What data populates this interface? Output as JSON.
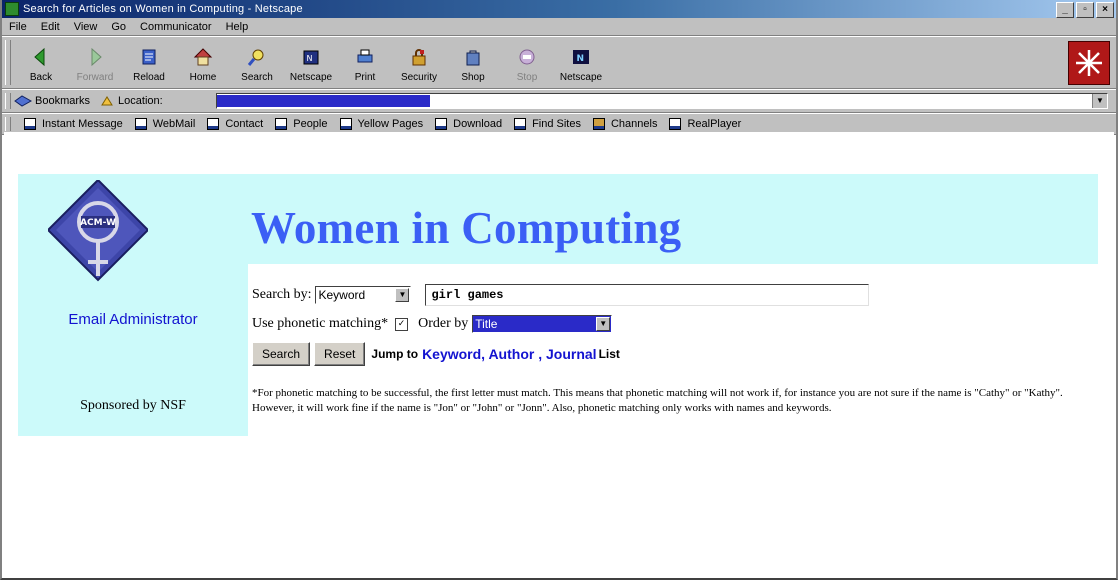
{
  "window": {
    "title": "Search for Articles on Women in Computing - Netscape",
    "controls": [
      "_",
      "▫",
      "×"
    ]
  },
  "menubar": [
    "File",
    "Edit",
    "View",
    "Go",
    "Communicator",
    "Help"
  ],
  "toolbar": {
    "buttons": [
      {
        "label": "Back",
        "icon": "back-arrow-icon",
        "enabled": true
      },
      {
        "label": "Forward",
        "icon": "forward-arrow-icon",
        "enabled": false
      },
      {
        "label": "Reload",
        "icon": "reload-icon",
        "enabled": true
      },
      {
        "label": "Home",
        "icon": "home-icon",
        "enabled": true
      },
      {
        "label": "Search",
        "icon": "search-icon",
        "enabled": true
      },
      {
        "label": "Netscape",
        "icon": "netscape-guide-icon",
        "enabled": true
      },
      {
        "label": "Print",
        "icon": "print-icon",
        "enabled": true
      },
      {
        "label": "Security",
        "icon": "security-icon",
        "enabled": true
      },
      {
        "label": "Shop",
        "icon": "shop-icon",
        "enabled": true
      },
      {
        "label": "Stop",
        "icon": "stop-icon",
        "enabled": false
      },
      {
        "label": "Netscape",
        "icon": "netscape-n-icon",
        "enabled": true
      }
    ]
  },
  "location_bar": {
    "bookmarks_label": "Bookmarks",
    "location_label": "Location:"
  },
  "personal_toolbar": [
    "Instant Message",
    "WebMail",
    "Contact",
    "People",
    "Yellow Pages",
    "Download",
    "Find Sites",
    "Channels",
    "RealPlayer"
  ],
  "page": {
    "logo_text": "ACM-W",
    "email_admin": "Email Administrator",
    "sponsor": "Sponsored by NSF",
    "title": "Women in Computing",
    "search_by_label": "Search by:",
    "search_by_value": "Keyword",
    "query_value": "girl games",
    "phonetic_label": "Use phonetic matching*",
    "phonetic_checked": true,
    "order_by_label": "Order by",
    "order_by_value": "Title",
    "search_button": "Search",
    "reset_button": "Reset",
    "jump_to_label": "Jump to",
    "jump_link_text": "Keyword, Author , Journal",
    "jump_tail": "List",
    "footnote": "*For phonetic matching to be successful, the first letter must match. This means that phonetic matching will not work if, for instance you are not sure if the name is \"Cathy\" or \"Kathy\". However, it will work fine if the name is \"Jon\" or \"John\" or \"Jonn\". Also, phonetic matching only works with names and keywords."
  }
}
